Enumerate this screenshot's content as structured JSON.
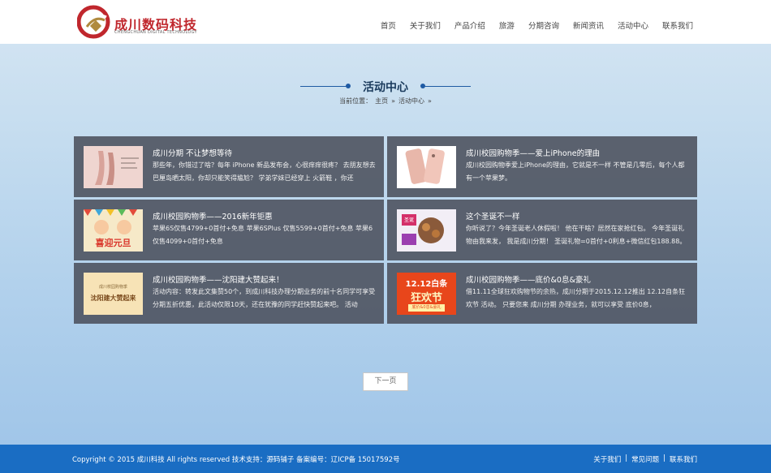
{
  "header": {
    "brand_cn": "成川数码科技",
    "brand_en": "CHENGCHUAN DIGITAL TECHNOLOGY",
    "nav": [
      "首页",
      "关于我们",
      "产品介绍",
      "旅游",
      "分期咨询",
      "新闻资讯",
      "活动中心",
      "联系我们"
    ]
  },
  "section": {
    "title": "活动中心",
    "breadcrumb": {
      "prefix": "当前位置：",
      "home": "主页",
      "sep1": "»",
      "current": "活动中心",
      "sep2": "»"
    }
  },
  "cards": [
    {
      "title": "成川分期 不让梦想等待",
      "desc": "那些年，你错过了啥？每年 iPhone 新品发布会，心很痒痒很疼？ 去朋友想去 巴厘岛晒太阳，你却只能笑得尴尬？ 学弟学妹已经穿上 火箭鞋 ，你还",
      "thumb_icon": "ballet-shoes-image"
    },
    {
      "title": "成川校园购物季——爱上iPhone的理由",
      "desc": "成川校园购物季爱上iPhone的理由，它就是不一样 不管是几零后，每个人都有一个苹果梦。",
      "thumb_icon": "iphone-image"
    },
    {
      "title": "成川校园购物季——2016新年钜惠",
      "desc": "苹果6S仅售4799+0首付+免息 苹果6SPlus 仅售5599+0首付+免息 苹果6仅售4099+0首付+免息",
      "thumb_icon": "new-year-image",
      "thumb_text": "喜迎元旦"
    },
    {
      "title": "这个圣诞不一样",
      "desc": "你听说了？今年圣诞老人休假啦！ 他在干啥？居然在家抢红包。 今年圣诞礼物由我来发， 我是成川分期！ 圣诞礼物=0首付+0利息+微信红包188.88。",
      "thumb_icon": "christmas-image",
      "thumb_text": "圣诞"
    },
    {
      "title": "成川校园购物季——沈阳建大赞起来！",
      "desc": "活动内容：转发此文集赞50个，到成川科技办理分期业务的前十名同学可享受分期五折优惠，此活动仅限10天，还在犹豫的同学赶快赞起来吧。 活动",
      "thumb_icon": "shenyang-jianda-image",
      "thumb_top": "成川校园购物季",
      "thumb_text": "沈阳建大赞起来"
    },
    {
      "title": "成川校园购物季——底价&0息&豪礼",
      "desc": "借11.11全球狂欢购物节的余热，成川分期于2015.12.12推出 12.12自条狂欢节 活动。 只要您来 成川分期 办理业务，就可以享受 底价0息，",
      "thumb_icon": "double-twelve-image",
      "thumb_top": "12.12白条",
      "thumb_text": "狂欢节",
      "thumb_bottom": "底价&0息&豪礼"
    }
  ],
  "pagination": {
    "next": "下一页"
  },
  "footer": {
    "copyright": "Copyright © 2015 成川科技 All rights reserved 技术支持：源码铺子 备案编号：辽ICP备 15017592号",
    "links": [
      "关于我们",
      "常见问题",
      "联系我们"
    ],
    "sep": "|"
  },
  "colors": {
    "brand_red": "#c0272d",
    "accent_blue": "#1f5aa3",
    "footer_blue": "#1a6dc3",
    "card_bg": "#4b505c"
  }
}
